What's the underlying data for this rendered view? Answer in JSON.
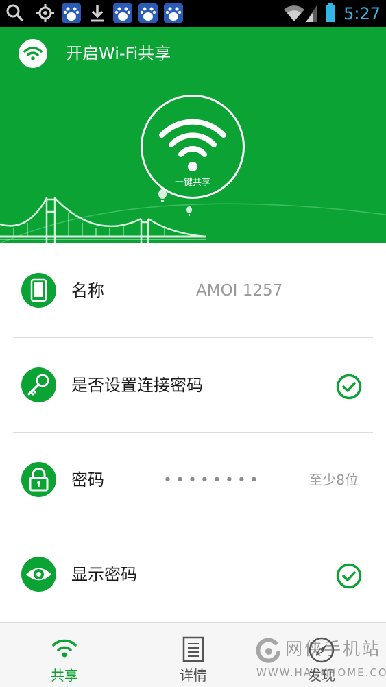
{
  "status_bar": {
    "time": "5:27",
    "icons": [
      "search-icon",
      "gps-icon",
      "baidu-icon",
      "download-icon",
      "baidu-icon",
      "baidu-icon",
      "baidu-icon",
      "wifi-signal-icon",
      "cell-signal-icon",
      "battery-icon"
    ]
  },
  "header": {
    "title": "开启Wi-Fi共享",
    "share_button_label": "一键共享",
    "color": "#0aa334"
  },
  "settings": {
    "name": {
      "label": "名称",
      "value": "AMOI 1257"
    },
    "set_password": {
      "label": "是否设置连接密码",
      "checked": true
    },
    "password": {
      "label": "密码",
      "value": "••••••••",
      "hint": "至少8位"
    },
    "show_password": {
      "label": "显示密码",
      "checked": true
    }
  },
  "bottom_nav": {
    "tabs": [
      {
        "label": "共享",
        "icon": "wifi-icon",
        "active": true
      },
      {
        "label": "详情",
        "icon": "document-icon",
        "active": false
      },
      {
        "label": "发现",
        "icon": "compass-icon",
        "active": false
      }
    ],
    "active_color": "#0aa334",
    "inactive_color": "#555555"
  },
  "watermark": {
    "text": "网侠手机站",
    "url": "WWW.HACKHOME.COM"
  }
}
